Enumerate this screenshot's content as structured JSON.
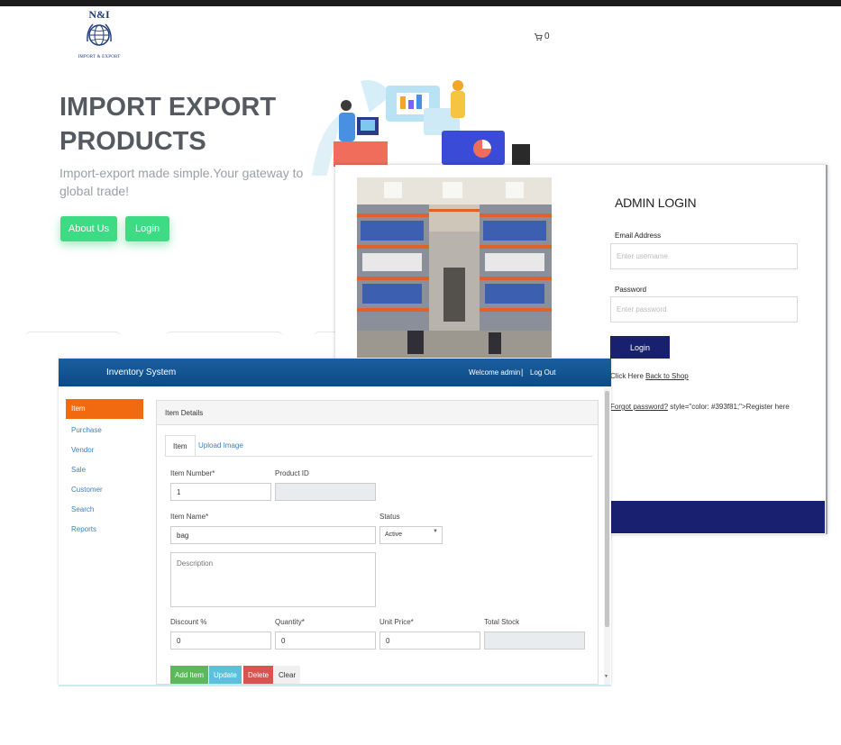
{
  "logo": {
    "title": "N&I",
    "subtitle": "IMPORT & EXPORT"
  },
  "cart": {
    "count": "0"
  },
  "hero": {
    "title": "IMPORT EXPORT PRODUCTS",
    "subtitle": "Import-export made simple.Your gateway to global trade!",
    "about_label": "About Us",
    "login_label": "Login"
  },
  "admin_login": {
    "title": "ADMIN LOGIN",
    "email_label": "Email Address",
    "email_placeholder": "Enter username",
    "password_label": "Password",
    "password_placeholder": "Enter password",
    "login_label": "Login",
    "back_prefix": "Click Here",
    "back_link": "Back to Shop",
    "forgot_link": "Forgot password?",
    "register_text": " style=\"color: #393f81;\">Register here"
  },
  "inventory": {
    "brand": "Inventory System",
    "welcome": "Welcome admin",
    "separator": "|",
    "logout": "Log Out",
    "sidebar": [
      "Item",
      "Purchase",
      "Vendor",
      "Sale",
      "Customer",
      "Search",
      "Reports"
    ],
    "panel_title": "Item Details",
    "tabs": [
      "Item",
      "Upload Image"
    ],
    "fields": {
      "item_number_label": "Item Number*",
      "item_number_value": "1",
      "product_id_label": "Product ID",
      "item_name_label": "Item Name*",
      "item_name_value": "bag",
      "status_label": "Status",
      "status_value": "Active",
      "description_placeholder": "Description",
      "discount_label": "Discount %",
      "discount_value": "0",
      "quantity_label": "Quantity*",
      "quantity_value": "0",
      "unit_price_label": "Unit Price*",
      "unit_price_value": "0",
      "total_stock_label": "Total Stock"
    },
    "buttons": {
      "add": "Add Item",
      "update": "Update",
      "delete": "Delete",
      "clear": "Clear"
    }
  },
  "colors": {
    "hero_green": "#3ddc84",
    "admin_navy": "#1a2070",
    "header_blue": "#0e4a85",
    "active_orange": "#f26a0f"
  }
}
